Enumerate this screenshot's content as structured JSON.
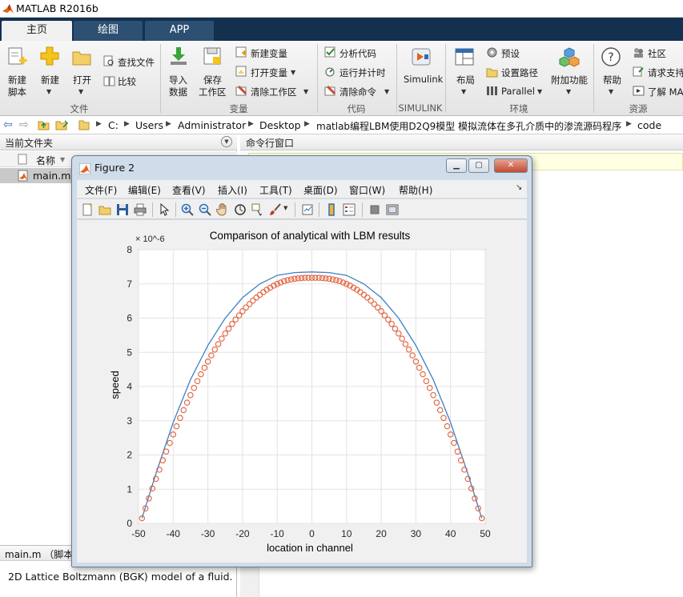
{
  "app": {
    "title": "MATLAB R2016b"
  },
  "tabs": [
    {
      "label": "主页"
    },
    {
      "label": "绘图"
    },
    {
      "label": "APP"
    }
  ],
  "ribbon": {
    "file": {
      "new_script": [
        "新建",
        "脚本"
      ],
      "new": "新建",
      "open": "打开",
      "find_files": "查找文件",
      "compare": "比较",
      "group": "文件"
    },
    "variable": {
      "import": [
        "导入",
        "数据"
      ],
      "save": [
        "保存",
        "工作区"
      ],
      "new_var": "新建变量",
      "open_var": "打开变量",
      "clear_ws": "清除工作区",
      "group": "变量"
    },
    "code": {
      "analyze": "分析代码",
      "run_time": "运行并计时",
      "clear_cmd": "清除命令",
      "group": "代码"
    },
    "simulink": {
      "label": "Simulink",
      "group": "SIMULINK"
    },
    "env": {
      "layout": "布局",
      "prefs": "预设",
      "set_path": "设置路径",
      "parallel": "Parallel",
      "addons": "附加功能",
      "group": "环境"
    },
    "resources": {
      "help": "帮助",
      "community": "社区",
      "support": "请求支持",
      "learn": "了解 MA",
      "group": "资源"
    }
  },
  "address": {
    "crumbs": [
      "C:",
      "Users",
      "Administrator",
      "Desktop",
      "matlab编程LBM使用D2Q9模型 模拟流体在多孔介质中的渗流源码程序",
      "code"
    ]
  },
  "current_folder": {
    "title": "当前文件夹",
    "col_name": "名称",
    "file": "main.m"
  },
  "details": {
    "header": "main.m （脚本）",
    "description": "2D Lattice Boltzmann (BGK) model of a fluid."
  },
  "command_window": {
    "title": "命令行窗口"
  },
  "figure": {
    "title": "Figure 2",
    "menu": [
      "文件(F)",
      "编辑(E)",
      "查看(V)",
      "插入(I)",
      "工具(T)",
      "桌面(D)",
      "窗口(W)",
      "帮助(H)"
    ]
  },
  "colors": {
    "analytical": "#3f7fc6",
    "lbm": "#e0603a",
    "tabbar": "#13304f"
  },
  "chart_data": {
    "type": "line",
    "title": "Comparison of analytical with LBM results",
    "xlabel": "location in channel",
    "ylabel": "speed",
    "exponent_label": "× 10^-6",
    "xlim": [
      -50,
      50
    ],
    "ylim": [
      0,
      8
    ],
    "xticks": [
      -50,
      -40,
      -30,
      -20,
      -10,
      0,
      10,
      20,
      30,
      40,
      50
    ],
    "yticks": [
      0,
      1,
      2,
      3,
      4,
      5,
      6,
      7,
      8
    ],
    "grid": true,
    "series": [
      {
        "style": "line",
        "color": "#3f7fc6",
        "x": [
          -49,
          -45,
          -40,
          -35,
          -30,
          -25,
          -20,
          -15,
          -10,
          -5,
          0,
          5,
          10,
          15,
          20,
          25,
          30,
          35,
          40,
          45,
          49
        ],
        "y": [
          0.15,
          1.45,
          2.95,
          4.2,
          5.2,
          6.0,
          6.6,
          7.0,
          7.25,
          7.33,
          7.35,
          7.33,
          7.25,
          7.0,
          6.6,
          6.0,
          5.2,
          4.2,
          2.95,
          1.45,
          0.15
        ]
      },
      {
        "style": "markers",
        "color": "#e0603a",
        "x": [
          -49,
          -48,
          -47,
          -46,
          -45,
          -44,
          -43,
          -42,
          -41,
          -40,
          -39,
          -38,
          -37,
          -36,
          -35,
          -34,
          -33,
          -32,
          -31,
          -30,
          -29,
          -28,
          -27,
          -26,
          -25,
          -24,
          -23,
          -22,
          -21,
          -20,
          -19,
          -18,
          -17,
          -16,
          -15,
          -14,
          -13,
          -12,
          -11,
          -10,
          -9,
          -8,
          -7,
          -6,
          -5,
          -4,
          -3,
          -2,
          -1,
          0,
          1,
          2,
          3,
          4,
          5,
          6,
          7,
          8,
          9,
          10,
          11,
          12,
          13,
          14,
          15,
          16,
          17,
          18,
          19,
          20,
          21,
          22,
          23,
          24,
          25,
          26,
          27,
          28,
          29,
          30,
          31,
          32,
          33,
          34,
          35,
          36,
          37,
          38,
          39,
          40,
          41,
          42,
          43,
          44,
          45,
          46,
          47,
          48,
          49
        ],
        "y": [
          0.15,
          0.44,
          0.73,
          1.02,
          1.3,
          1.57,
          1.84,
          2.1,
          2.35,
          2.6,
          2.84,
          3.08,
          3.31,
          3.53,
          3.75,
          3.96,
          4.16,
          4.36,
          4.55,
          4.73,
          4.91,
          5.08,
          5.24,
          5.4,
          5.55,
          5.69,
          5.83,
          5.96,
          6.08,
          6.2,
          6.31,
          6.41,
          6.51,
          6.6,
          6.68,
          6.76,
          6.83,
          6.89,
          6.95,
          7.0,
          7.04,
          7.08,
          7.11,
          7.13,
          7.15,
          7.16,
          7.17,
          7.18,
          7.18,
          7.18,
          7.18,
          7.18,
          7.17,
          7.16,
          7.15,
          7.13,
          7.11,
          7.08,
          7.04,
          7.0,
          6.95,
          6.89,
          6.83,
          6.76,
          6.68,
          6.6,
          6.51,
          6.41,
          6.31,
          6.2,
          6.08,
          5.96,
          5.83,
          5.69,
          5.55,
          5.4,
          5.24,
          5.08,
          4.91,
          4.73,
          4.55,
          4.36,
          4.16,
          3.96,
          3.75,
          3.53,
          3.31,
          3.08,
          2.84,
          2.6,
          2.35,
          2.1,
          1.84,
          1.57,
          1.3,
          1.02,
          0.73,
          0.44,
          0.15
        ]
      }
    ]
  }
}
